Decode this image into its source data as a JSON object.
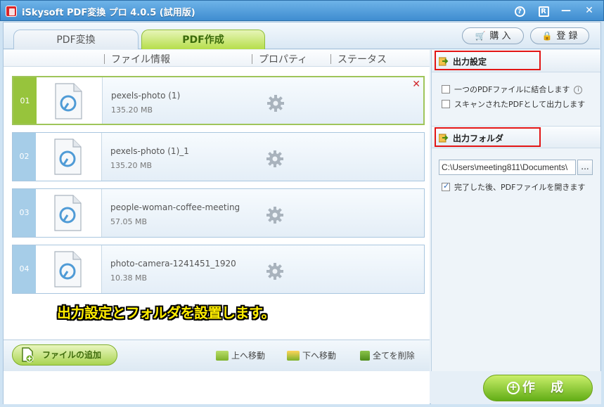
{
  "window": {
    "title": "iSkysoft PDF変換 プロ 4.0.5 (試用版)",
    "help_glyph": "?",
    "register_glyph": "R",
    "minimize_glyph": "—",
    "close_glyph": "✕"
  },
  "tabs": [
    {
      "label": "PDF変換",
      "active": false
    },
    {
      "label": "PDF作成",
      "active": true
    }
  ],
  "toolbar": {
    "buy_label": "購 入",
    "register_label": "登 録"
  },
  "columns": [
    "ファイル情報",
    "プロパティ",
    "ステータス"
  ],
  "files": [
    {
      "num": "01",
      "name": "pexels-photo (1)",
      "size": "135.20  MB",
      "selected": true
    },
    {
      "num": "02",
      "name": "pexels-photo (1)_1",
      "size": "135.20  MB",
      "selected": false
    },
    {
      "num": "03",
      "name": "people-woman-coffee-meeting",
      "size": "57.05  MB",
      "selected": false
    },
    {
      "num": "04",
      "name": "photo-camera-1241451_1920",
      "size": "10.38  MB",
      "selected": false
    }
  ],
  "delete_glyph": "✕",
  "instruction": "出力設定とフォルダを設置します。",
  "bottom": {
    "add_file_label": "ファイルの追加",
    "move_up_label": "上へ移動",
    "move_down_label": "下へ移動",
    "delete_all_label": "全てを削除"
  },
  "output_settings": {
    "title": "出力設定",
    "merge_label": "一つのPDFファイルに結合します",
    "info_glyph": "i",
    "scan_label": "スキャンされたPDFとして出力します",
    "merge_checked": false,
    "scan_checked": false
  },
  "output_folder": {
    "title": "出力フォルダ",
    "path": "C:\\Users\\meeting811\\Documents\\",
    "browse_label": "...",
    "open_after_label": "完了した後、PDFファイルを開きます",
    "open_after_checked": true
  },
  "create": {
    "icon_glyph": "+",
    "label": "作 成"
  },
  "colors": {
    "accent_green": "#97c43c",
    "title_blue": "#3f8dd0",
    "highlight_red": "#e21515",
    "instruction_yellow": "#ffec00"
  }
}
